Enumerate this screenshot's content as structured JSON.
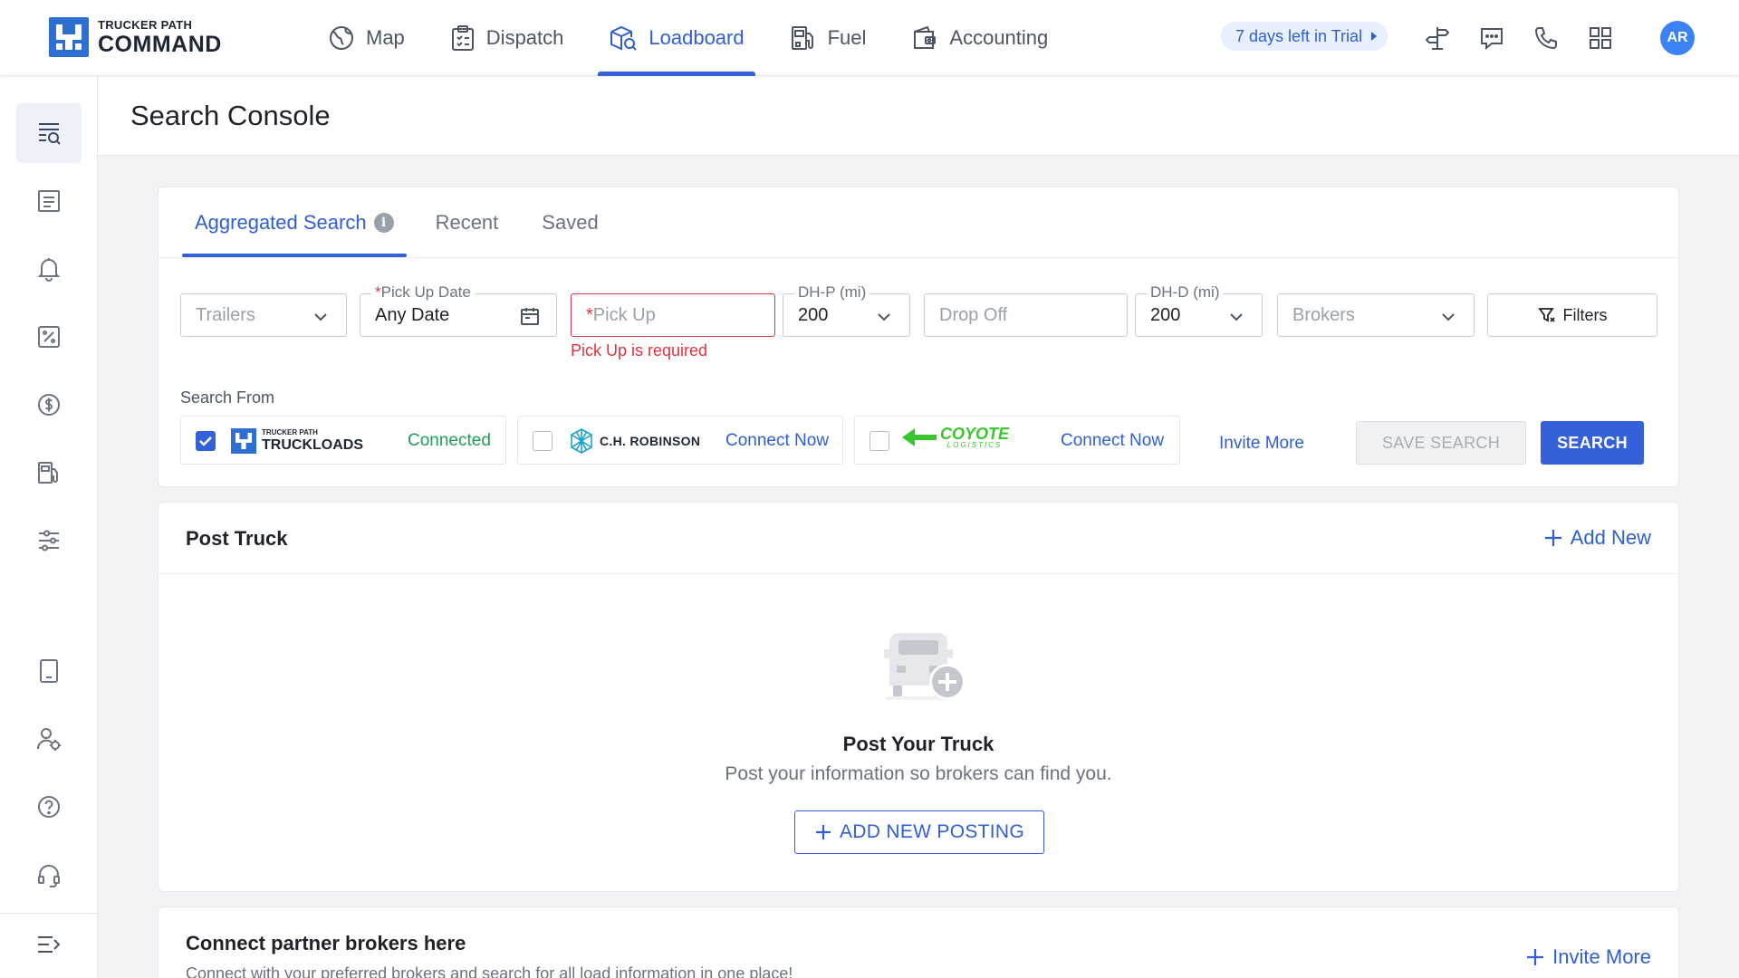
{
  "brand": {
    "small": "TRUCKER PATH",
    "big": "COMMAND",
    "color": "#2d6fd1"
  },
  "nav": {
    "items": [
      {
        "label": "Map",
        "icon": "map-globe-icon"
      },
      {
        "label": "Dispatch",
        "icon": "clipboard-icon"
      },
      {
        "label": "Loadboard",
        "icon": "box-search-icon",
        "active": true
      },
      {
        "label": "Fuel",
        "icon": "fuel-pump-icon"
      },
      {
        "label": "Accounting",
        "icon": "wallet-icon"
      }
    ],
    "trial": "7 days left in Trial",
    "avatar": "AR",
    "accent": "#3461d8"
  },
  "sidebar": {
    "items": [
      "search-console-icon",
      "list-icon",
      "bell-icon",
      "percent-icon",
      "dollar-icon",
      "fuel-icon",
      "sliders-icon",
      "tablet-icon",
      "user-settings-icon",
      "help-icon",
      "headset-icon",
      "menu-collapse-icon"
    ]
  },
  "page": {
    "title": "Search Console"
  },
  "search": {
    "tabs": {
      "aggregated": "Aggregated Search",
      "info": "i",
      "recent": "Recent",
      "saved": "Saved"
    },
    "trailers": {
      "placeholder": "Trailers"
    },
    "pickup_date": {
      "label": "Pick Up Date",
      "required_mark": "*",
      "value": "Any Date"
    },
    "pickup": {
      "placeholder": "Pick Up",
      "required_mark": "*",
      "error": "Pick Up is required"
    },
    "dhp": {
      "label": "DH-P (mi)",
      "value": "200"
    },
    "dropoff": {
      "placeholder": "Drop Off"
    },
    "dhd": {
      "label": "DH-D (mi)",
      "value": "200"
    },
    "brokers": {
      "placeholder": "Brokers"
    },
    "filters": "Filters",
    "search_from": "Search From",
    "sources": [
      {
        "small": "TRUCKER PATH",
        "name": "TRUCKLOADS",
        "status": "Connected",
        "checked": true
      },
      {
        "name": "C.H. ROBINSON",
        "status": "Connect Now",
        "checked": false
      },
      {
        "name": "COYOTE",
        "sub": "LOGISTICS",
        "status": "Connect Now",
        "checked": false
      }
    ],
    "invite_more": "Invite More",
    "save_search": "SAVE SEARCH",
    "search_btn": "SEARCH"
  },
  "post_truck": {
    "title": "Post Truck",
    "add_new": "Add New",
    "empty_title": "Post Your Truck",
    "empty_sub": "Post your information so brokers can find you.",
    "add_posting": "ADD NEW POSTING"
  },
  "partners": {
    "title": "Connect partner brokers here",
    "sub": "Connect with your preferred brokers and search for all load information in one place!",
    "invite_more": "Invite More"
  }
}
